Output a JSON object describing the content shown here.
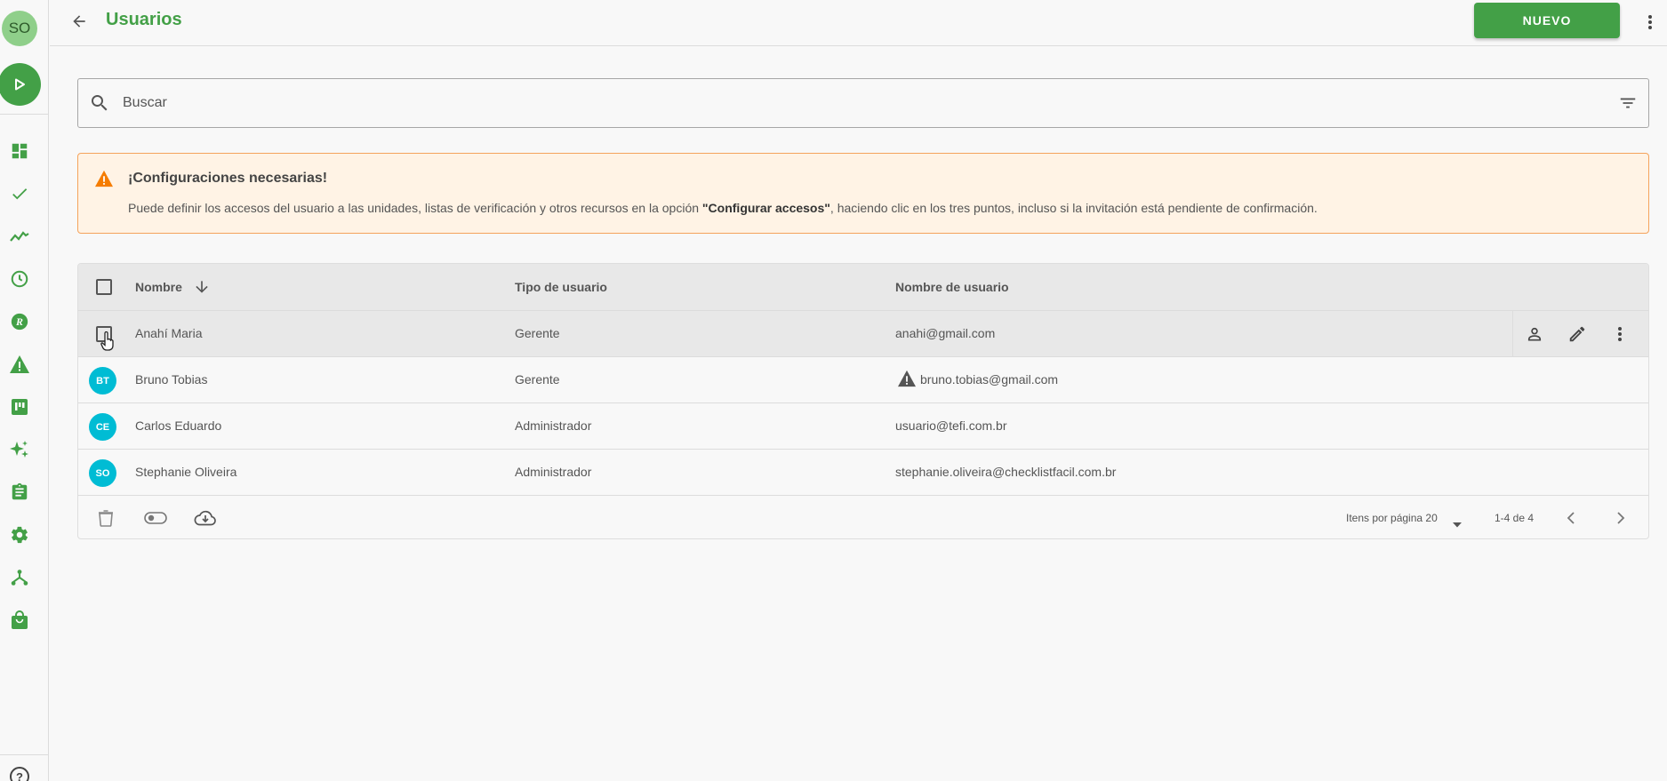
{
  "sidebar": {
    "avatar_initials": "SO",
    "items": [
      {
        "icon": "dashboard-icon"
      },
      {
        "icon": "check-icon"
      },
      {
        "icon": "trending-icon"
      },
      {
        "icon": "clock-icon"
      },
      {
        "icon": "r-circle-icon"
      },
      {
        "icon": "warning-icon"
      },
      {
        "icon": "board-icon"
      },
      {
        "icon": "sparkles-icon"
      },
      {
        "icon": "clipboard-icon"
      },
      {
        "icon": "gear-icon"
      },
      {
        "icon": "hierarchy-icon"
      },
      {
        "icon": "shopping-bag-icon"
      }
    ],
    "help_icon": "help-icon"
  },
  "header": {
    "title": "Usuarios",
    "new_button_label": "NUEVO"
  },
  "search": {
    "placeholder": "Buscar"
  },
  "alert": {
    "title": "¡Configuraciones necesarias!",
    "body_before": "Puede definir los accesos del usuario a las unidades, listas de verificación y otros recursos en la opción ",
    "body_bold": "\"Configurar accesos\"",
    "body_after": ", haciendo clic en los tres puntos, incluso si la invitación está pendiente de confirmación."
  },
  "table": {
    "columns": {
      "name": "Nombre",
      "type": "Tipo de usuario",
      "username": "Nombre de usuario"
    },
    "rows": [
      {
        "initials": "",
        "name": "Anahí Maria",
        "type": "Gerente",
        "username": "anahi@gmail.com",
        "warning": false,
        "hovered": true
      },
      {
        "initials": "BT",
        "name": "Bruno Tobias",
        "type": "Gerente",
        "username": "bruno.tobias@gmail.com",
        "warning": true,
        "hovered": false
      },
      {
        "initials": "CE",
        "name": "Carlos Eduardo",
        "type": "Administrador",
        "username": "usuario@tefi.com.br",
        "warning": false,
        "hovered": false
      },
      {
        "initials": "SO",
        "name": "Stephanie Oliveira",
        "type": "Administrador",
        "username": "stephanie.oliveira@checklistfacil.com.br",
        "warning": false,
        "hovered": false
      }
    ],
    "footer": {
      "per_page_label": "Itens por página 20",
      "range": "1-4 de 4"
    }
  },
  "colors": {
    "brand_green": "#43a047",
    "avatar_cyan": "#00bcd4",
    "alert_border": "#f5a35c",
    "alert_bg": "#fff3e5",
    "warning_orange": "#f57c00"
  }
}
